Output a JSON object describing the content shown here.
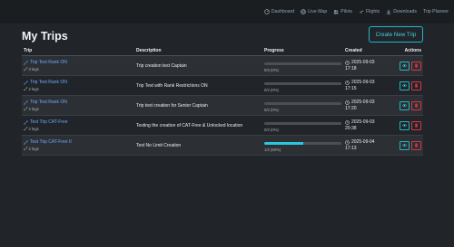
{
  "nav": {
    "items": [
      {
        "label": "Dashboard",
        "icon": "gauge-icon"
      },
      {
        "label": "Live Map",
        "icon": "globe-icon"
      },
      {
        "label": "Pilots",
        "icon": "pilots-icon"
      },
      {
        "label": "Flights",
        "icon": "plane-icon"
      },
      {
        "label": "Downloads",
        "icon": "download-icon"
      },
      {
        "label": "Trip Planner",
        "icon": ""
      }
    ]
  },
  "header": {
    "title": "My Trips",
    "new_trip_label": "Create New Trip"
  },
  "table": {
    "columns": {
      "trip": "Trip",
      "description": "Description",
      "progress": "Progress",
      "created": "Created",
      "actions": "Actions"
    },
    "rows": [
      {
        "name": "Trip Test Rank ON",
        "legs": "3 legs",
        "description": "Trip creation test Captain",
        "progress_fraction": 0,
        "progress_text": "0/3 (0%)",
        "date": "2025-09-03",
        "time": "17:18"
      },
      {
        "name": "Trip Test Rank ON",
        "legs": "2 legs",
        "description": "Trip Test with Rank Restrictions ON",
        "progress_fraction": 0,
        "progress_text": "0/2 (0%)",
        "date": "2025-09-03",
        "time": "17:15"
      },
      {
        "name": "Trip Test Rank ON",
        "legs": "2 legs",
        "description": "Trip test creation for Senior Captain",
        "progress_fraction": 0,
        "progress_text": "0/2 (0%)",
        "date": "2025-09-03",
        "time": "17:20"
      },
      {
        "name": "Test Trip CAT-Free",
        "legs": "2 legs",
        "description": "Testing the creation of CAT-Free & Unlocked location",
        "progress_fraction": 0,
        "progress_text": "0/2 (0%)",
        "date": "2025-09-03",
        "time": "20:38"
      },
      {
        "name": "Test Trip CAT-Free II",
        "legs": "2 legs",
        "description": "Test No Limit Creation",
        "progress_fraction": 0.5,
        "progress_text": "1/2 (50%)",
        "date": "2025-09-04",
        "time": "17:13"
      }
    ]
  },
  "colors": {
    "accent": "#2cc6dc",
    "link": "#6ea8fe",
    "danger": "#dc3545",
    "background": "#212529"
  }
}
